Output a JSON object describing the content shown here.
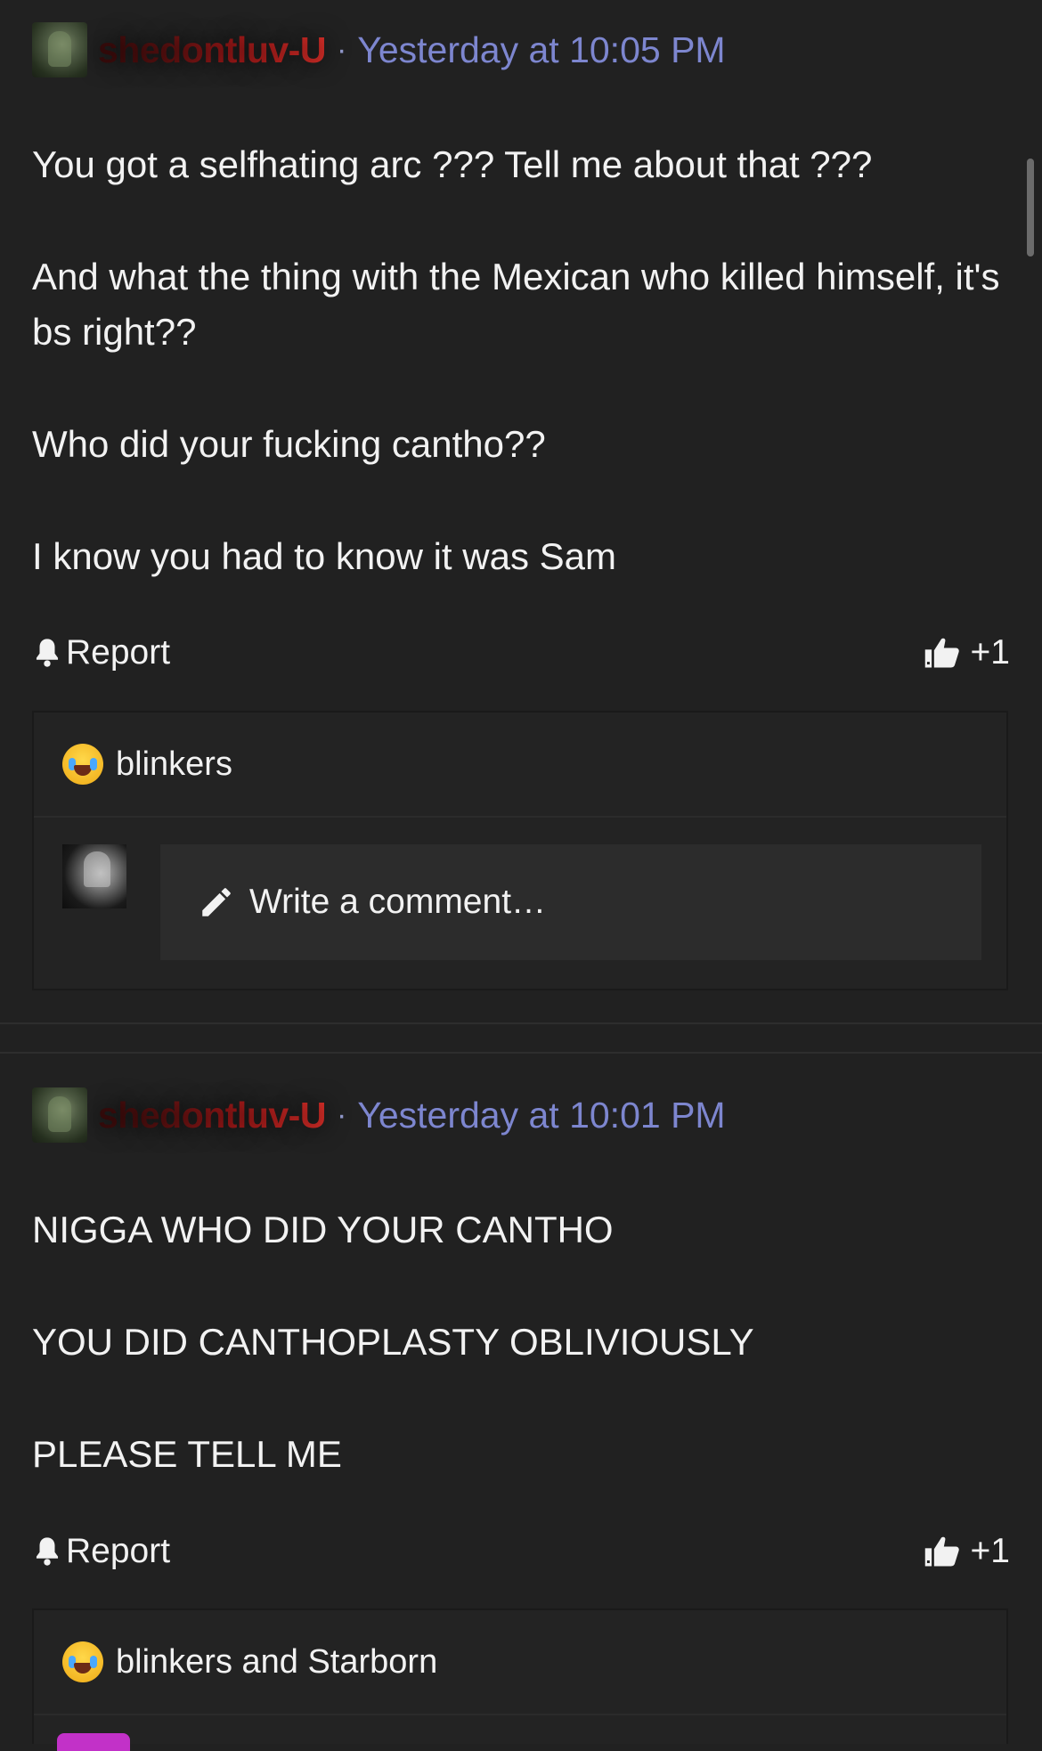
{
  "posts": [
    {
      "author": "shedontluv-U",
      "separator": "·",
      "timestamp": "Yesterday at 10:05 PM",
      "paragraphs": [
        "You got a selfhating arc ??? Tell me about that ???",
        "And what the thing with the Mexican who killed himself, it's bs right??",
        "Who did your fucking cantho??",
        "I know you had to know it was Sam"
      ],
      "report_label": "Report",
      "like_count": "+1",
      "reactions": "blinkers",
      "comment_placeholder": "Write a comment…"
    },
    {
      "author": "shedontluv-U",
      "separator": "·",
      "timestamp": "Yesterday at 10:01 PM",
      "paragraphs": [
        "NIGGA WHO DID YOUR CANTHO",
        "YOU DID CANTHOPLASTY OBLIVIOUSLY",
        "PLEASE TELL ME"
      ],
      "report_label": "Report",
      "like_count": "+1",
      "reactions": "blinkers and Starborn"
    }
  ],
  "colors": {
    "background": "#212121",
    "timestamp": "#7d86cf",
    "username_red": "#e0302a",
    "text": "#f2f2f2"
  },
  "icons": {
    "report": "bell-icon",
    "like": "thumbs-up-icon",
    "comment": "pencil-icon",
    "reaction": "joy-tears-emoji-icon"
  }
}
